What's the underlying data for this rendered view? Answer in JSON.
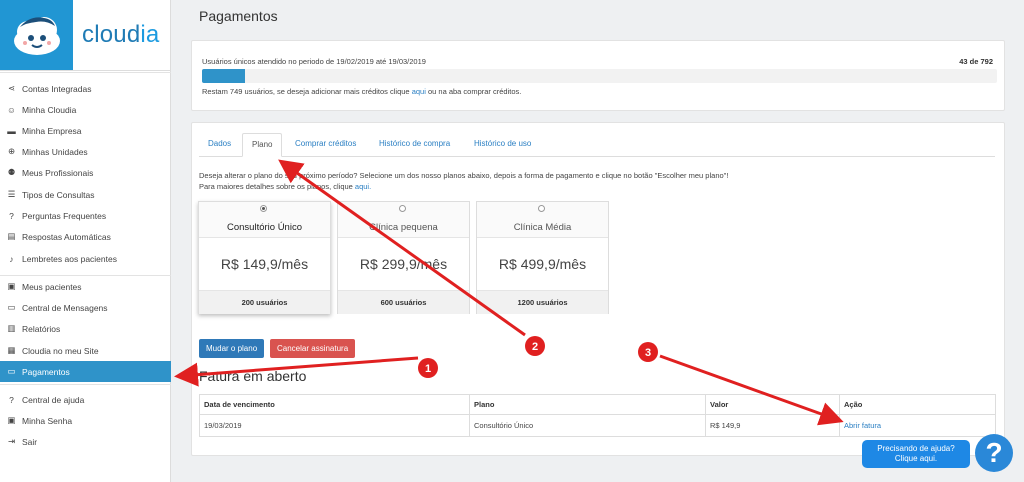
{
  "brand": {
    "name_prefix": "cloud",
    "name_suffix": "ia"
  },
  "sidebar": {
    "items": [
      {
        "label": "Contas Integradas",
        "icon": "share-icon"
      },
      {
        "label": "Minha Cloudia",
        "icon": "cloud-face-icon"
      },
      {
        "label": "Minha Empresa",
        "icon": "store-icon"
      },
      {
        "label": "Minhas Unidades",
        "icon": "plus-circle-icon"
      },
      {
        "label": "Meus Profissionais",
        "icon": "people-icon"
      },
      {
        "label": "Tipos de Consultas",
        "icon": "list-icon"
      },
      {
        "label": "Perguntas Frequentes",
        "icon": "question-box-icon"
      },
      {
        "label": "Respostas Automáticas",
        "icon": "chat-icon"
      },
      {
        "label": "Lembretes aos pacientes",
        "icon": "bell-icon"
      },
      {
        "label": "Meus pacientes",
        "icon": "contact-icon"
      },
      {
        "label": "Central de Mensagens",
        "icon": "message-icon"
      },
      {
        "label": "Relatórios",
        "icon": "bar-chart-icon"
      },
      {
        "label": "Cloudia no meu Site",
        "icon": "widgets-icon"
      },
      {
        "label": "Pagamentos",
        "icon": "credit-card-icon"
      },
      {
        "label": "Central de ajuda",
        "icon": "help-circle-icon"
      },
      {
        "label": "Minha Senha",
        "icon": "lock-icon"
      },
      {
        "label": "Sair",
        "icon": "logout-icon"
      }
    ],
    "active_index": 13
  },
  "page": {
    "title": "Pagamentos"
  },
  "usage": {
    "text": "Usuários únicos atendido no periodo de 19/02/2019 até 19/03/2019",
    "count": "43 de 792",
    "fraction": 0.054,
    "remain_prefix": "Restam 749 usuários, se deseja adicionar mais créditos clique ",
    "remain_link": "aqui",
    "remain_suffix": " ou na aba comprar créditos."
  },
  "tabs": [
    {
      "label": "Dados"
    },
    {
      "label": "Plano",
      "active": true
    },
    {
      "label": "Comprar créditos"
    },
    {
      "label": "Histórico de compra"
    },
    {
      "label": "Histórico de uso"
    }
  ],
  "intro": {
    "line1": "Deseja alterar o plano do seu próximo período? Selecione um dos nosso planos abaixo, depois a forma de pagamento e clique no botão \"Escolher meu plano\"!",
    "line2_prefix": "Para maiores detalhes sobre os planos, clique ",
    "line2_link": "aqui."
  },
  "plans": [
    {
      "name": "Consultório Único",
      "price": "R$ 149,9/mês",
      "users": "200 usuários",
      "selected": true
    },
    {
      "name": "Clínica pequena",
      "price": "R$ 299,9/mês",
      "users": "600 usuários",
      "selected": false
    },
    {
      "name": "Clínica Média",
      "price": "R$ 499,9/mês",
      "users": "1200 usuários",
      "selected": false
    }
  ],
  "buttons": {
    "change_plan": "Mudar o plano",
    "cancel": "Cancelar assinatura"
  },
  "invoices": {
    "title": "Fatura em aberto",
    "headers": [
      "Data de vencimento",
      "Plano",
      "Valor",
      "Ação"
    ],
    "rows": [
      {
        "due": "19/03/2019",
        "plan": "Consultório Único",
        "value": "R$ 149,9",
        "action": "Abrir fatura"
      }
    ]
  },
  "help": {
    "line1": "Precisando de ajuda?",
    "line2": "Clique aqui.",
    "icon": "?"
  },
  "annotations": {
    "badges": [
      "1",
      "2",
      "3"
    ],
    "color": "#e02020"
  },
  "colors": {
    "accent": "#2f93c9",
    "logo_bg": "#2196d3",
    "danger": "#d9534f",
    "primary_btn": "#2f79b8"
  }
}
